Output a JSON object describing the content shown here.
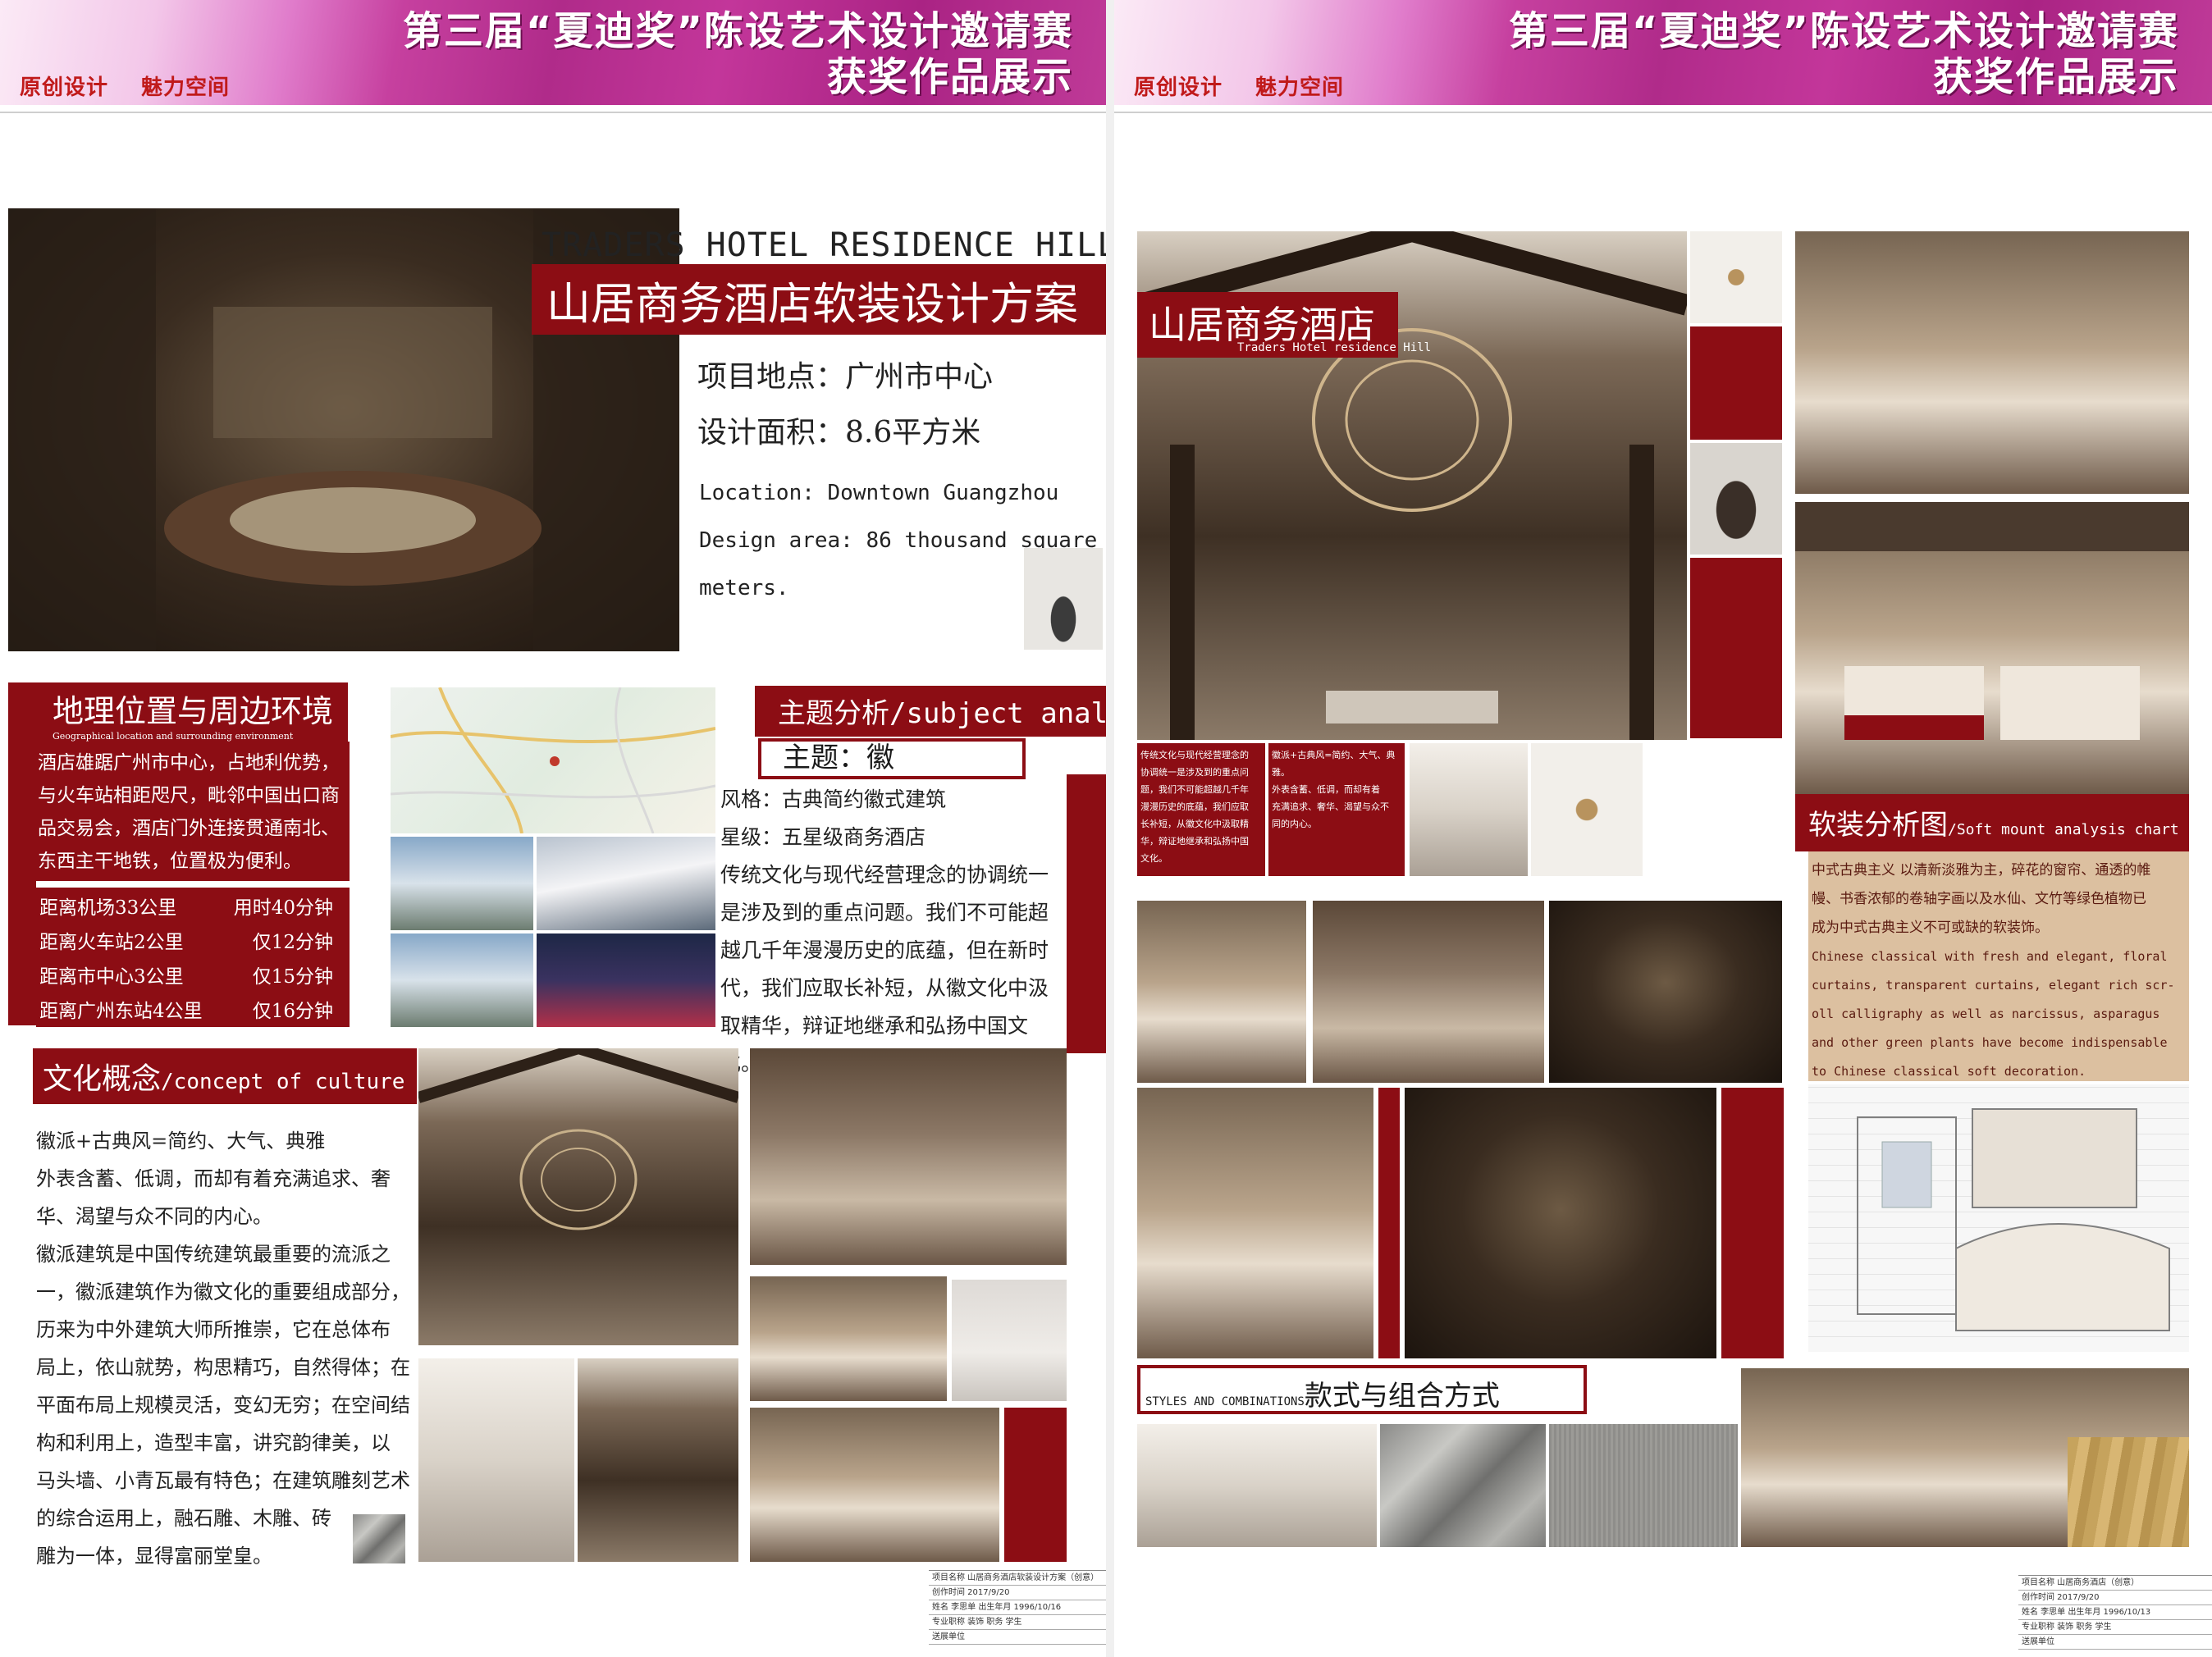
{
  "banner": {
    "title_line1": "第三届“夏迪奖”陈设艺术设计邀请赛",
    "title_line2": "获奖作品展示",
    "tagline_1": "原创设计",
    "tagline_2": "魅力空间"
  },
  "poster1": {
    "en_title": "TRADERS HOTEL RESIDENCE HILL",
    "cn_title": "山居商务酒店软装设计方案",
    "location_cn": "项目地点：广州市中心",
    "area_cn": "设计面积：8.6平方米",
    "location_en": "Location: Downtown Guangzhou",
    "area_en": "Design area: 86 thousand square",
    "area_en_2": "meters.",
    "geo": {
      "title": "地理位置与周边环境",
      "subtitle": "Geographical location and surrounding environment",
      "body": [
        "酒店雄踞广州市中心，占地利优势，",
        "与火车站相距咫尺，毗邻中国出口商",
        "品交易会，酒店门外连接贯通南北、",
        "东西主干地铁，位置极为便利。"
      ],
      "distances": [
        {
          "place": "距离机场33公里",
          "time": "用时40分钟"
        },
        {
          "place": "距离火车站2公里",
          "time": "仅12分钟"
        },
        {
          "place": "距离市中心3公里",
          "time": "仅15分钟"
        },
        {
          "place": "距离广州东站4公里",
          "time": "仅16分钟"
        }
      ]
    },
    "subject": {
      "title": "主题分析/subject anal",
      "theme": "主题：徽",
      "body": [
        "风格：古典简约徽式建筑",
        "星级：五星级商务酒店",
        "传统文化与现代经营理念的协调统一",
        "是涉及到的重点问题。我们不可能超",
        "越几千年漫漫历史的底蕴，但在新时",
        "代，我们应取长补短，从徽文化中汲",
        "取精华，辩证地继承和弘扬中国文化。"
      ]
    },
    "culture": {
      "title_cn": "文化概念",
      "title_en": "/concept of culture",
      "body": [
        "徽派+古典风=简约、大气、典雅",
        "外表含蓄、低调，而却有着充满追求、奢",
        "华、渴望与众不同的内心。",
        "徽派建筑是中国传统建筑最重要的流派之",
        "一，徽派建筑作为徽文化的重要组成部分，",
        "历来为中外建筑大师所推崇，它在总体布",
        "局上，依山就势，构思精巧，自然得体；在",
        "平面布局上规模灵活，变幻无穷；在空间结",
        "构和利用上，造型丰富，讲究韵律美，以",
        "马头墙、小青瓦最有特色；在建筑雕刻艺术",
        "的综合运用上，融石雕、木雕、砖",
        "雕为一体，显得富丽堂皇。"
      ]
    },
    "info": [
      "项目名称  山居商务酒店软装设计方案（创意）",
      "创作时间  2017/9/20",
      "姓名  李思单  出生年月 1996/10/16",
      "专业职称  装饰  职务  学生",
      "送展单位"
    ]
  },
  "poster2": {
    "hero_title": "山居商务酒店",
    "hero_subtitle": "Traders Hotel residence Hill",
    "small_text_1": [
      "传统文化与现代经营理念的",
      "协调统一是涉及到的重点问",
      "题，我们不可能超越几千年",
      "漫漫历史的底蕴，我们应取",
      "长补短，从徽文化中汲取精",
      "华，辩证地继承和弘扬中国",
      "文化。"
    ],
    "small_text_2": [
      "徽派+古典风=简约、大气、典",
      "雅。",
      "外表含蓄、低调，而却有着",
      "充满追求、奢华、渴望与众不",
      "同的内心。"
    ],
    "soft": {
      "title_cn": "软装分析图",
      "title_en": "/Soft mount analysis chart",
      "body_cn": [
        "中式古典主义 以清新淡雅为主，碎花的窗帘、通透的帷",
        "幔、书香浓郁的卷轴字画以及水仙、文竹等绿色植物已",
        "成为中式古典主义不可或缺的软装饰。"
      ],
      "body_en": [
        "Chinese classical with fresh and elegant, floral",
        "curtains, transparent curtains, elegant rich scr-",
        "oll calligraphy as well as narcissus, asparagus",
        "and other green plants have become indispensable",
        "to Chinese classical soft decoration."
      ]
    },
    "styles": {
      "label_en": "STYLES AND COMBINATIONS",
      "label_cn": "款式与组合方式"
    },
    "info": [
      "项目名称  山居商务酒店（创意）",
      "创作时间  2017/9/20",
      "姓名  李思单  出生年月 1996/10/13",
      "专业职称  装饰  职务  学生",
      "送展单位"
    ]
  }
}
